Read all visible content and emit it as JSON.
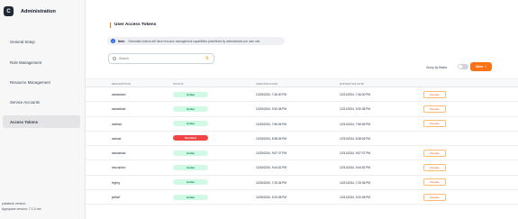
{
  "brand": {
    "logo_letter": "C",
    "title": "Administration"
  },
  "sidebar": {
    "items": [
      {
        "label": "General Setup"
      },
      {
        "label": "Role Management"
      },
      {
        "label": "Resource Management"
      },
      {
        "label": "Service Accounts"
      },
      {
        "label": "Access Tokens"
      }
    ],
    "footer": {
      "line1": "passteck version:",
      "line2": "Appspace version: 7.1.0-mh"
    }
  },
  "main": {
    "title": "User Access Tokens",
    "note": {
      "label": "Note:",
      "text": "Generated tokens will have resource management capabilities predefined by administrator per user role."
    },
    "search": {
      "placeholder": "Search"
    },
    "group_by_label": "Group by Status",
    "new_button": "New",
    "table": {
      "headers": [
        "DESCRIPTION",
        "STATUS",
        "CREATION DATE",
        "EXPIRATION DATE"
      ],
      "rows": [
        {
          "desc": "asdasdasd",
          "status": "Active",
          "created": "12/26/2024, 7:46:30 PM",
          "expires": "12/31/2024, 7:46:30 PM",
          "action": "Revoke"
        },
        {
          "desc": "asdasfdasf",
          "status": "Active",
          "created": "12/26/2024, 9:30:38 PM",
          "expires": "12/31/2024, 9:30:38 PM",
          "action": "Revoke"
        },
        {
          "desc": "asdfasd",
          "status": "Active",
          "created": "12/26/2024, 7:56:06 PM",
          "expires": "12/31/2024, 7:56:06 PM",
          "action": "Revoke"
        },
        {
          "desc": "asdsad",
          "status": "Revoked",
          "created": "12/26/2024, 8:38:06 PM",
          "expires": "12/31/2024, 8:38:06 PM",
          "action": ""
        },
        {
          "desc": "asdsadsad",
          "status": "Active",
          "created": "12/26/2024, 9:57:37 PM",
          "expires": "12/31/2024, 9:57:37 PM",
          "action": "Revoke"
        },
        {
          "desc": "description",
          "status": "Active",
          "created": "12/26/2024, 9:44:52 PM",
          "expires": "12/31/2024, 9:44:52 PM",
          "action": "Revoke"
        },
        {
          "desc": "fegfeg",
          "status": "Active",
          "created": "12/26/2024, 7:25:36 PM",
          "expires": "12/31/2024, 7:25:36 PM",
          "action": "Revoke"
        },
        {
          "desc": "jsdfsdf",
          "status": "Active",
          "created": "12/26/2024, 9:20:08 PM",
          "expires": "12/31/2024, 9:20:08 PM",
          "action": "Revoke"
        }
      ]
    }
  },
  "colors": {
    "accent": "#f97316",
    "active_badge": "#d1fae5",
    "revoked_badge": "#ef4444"
  }
}
